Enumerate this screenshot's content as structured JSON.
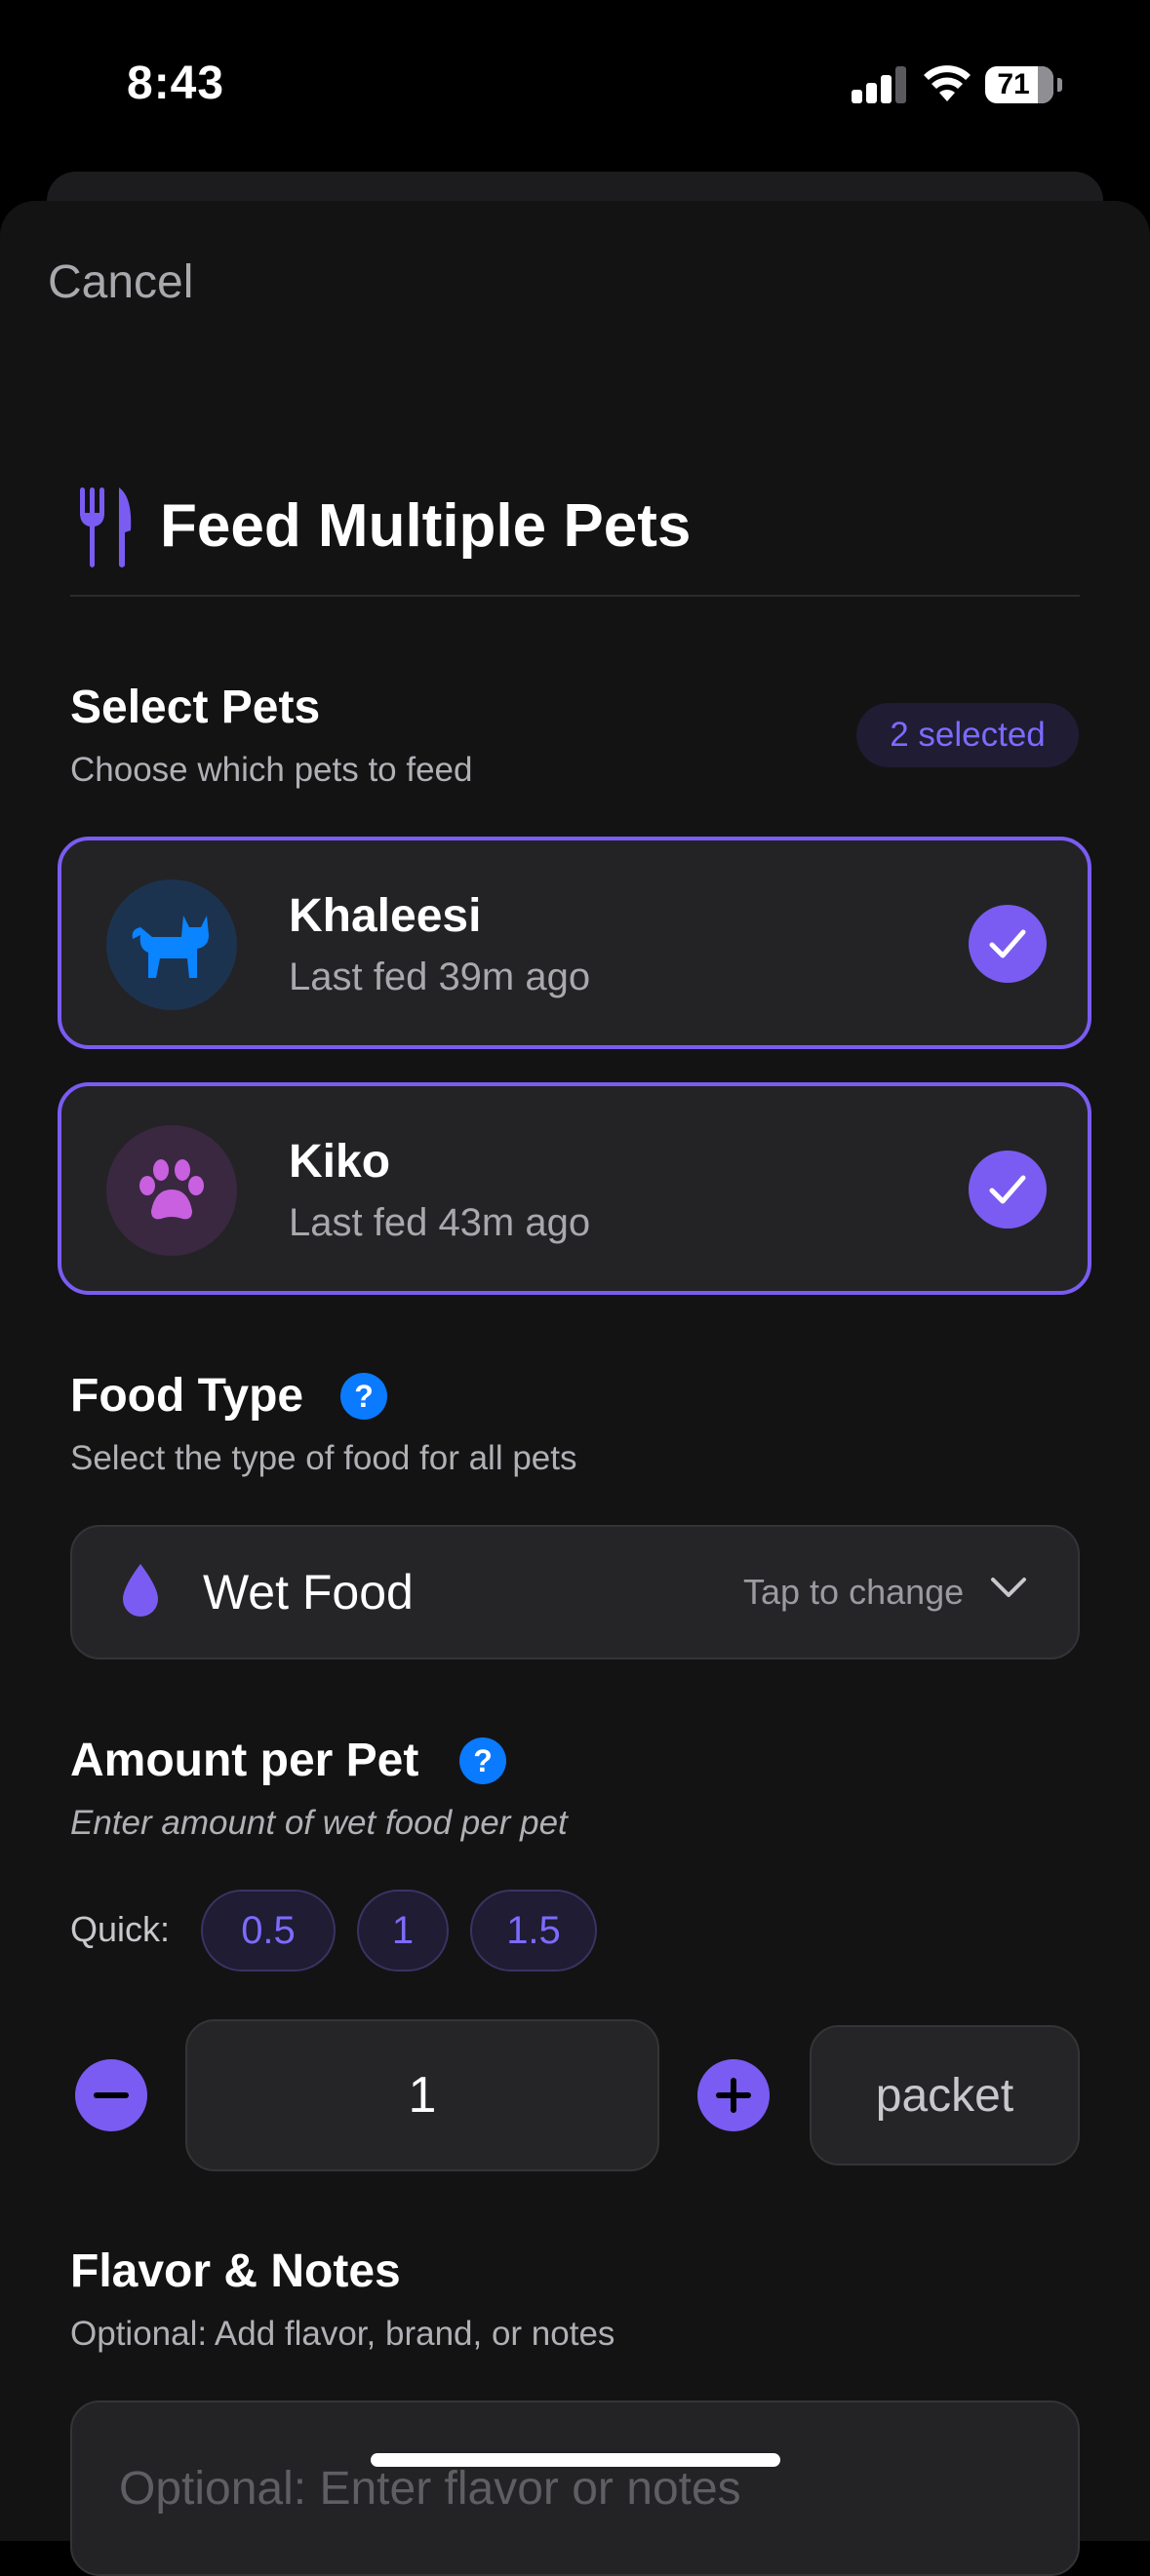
{
  "status_bar": {
    "time": "8:43",
    "battery": "71"
  },
  "header": {
    "cancel_label": "Cancel",
    "title": "Feed Multiple Pets"
  },
  "select_pets": {
    "title": "Select Pets",
    "subtitle": "Choose which pets to feed",
    "badge": "2 selected",
    "pets": [
      {
        "name": "Khaleesi",
        "last_fed": "Last fed 39m ago",
        "icon": "cat-icon",
        "selected": true
      },
      {
        "name": "Kiko",
        "last_fed": "Last fed 43m ago",
        "icon": "paw-icon",
        "selected": true
      }
    ]
  },
  "food_type": {
    "title": "Food Type",
    "subtitle": "Select the type of food for all pets",
    "selected": "Wet Food",
    "hint": "Tap to change"
  },
  "amount": {
    "title": "Amount per Pet",
    "subtitle": "Enter amount of wet food per pet",
    "quick_label": "Quick:",
    "quick_options": [
      "0.5",
      "1",
      "1.5"
    ],
    "value": "1",
    "unit": "packet"
  },
  "notes": {
    "title": "Flavor & Notes",
    "subtitle": "Optional: Add flavor, brand, or notes",
    "placeholder": "Optional: Enter flavor or notes"
  },
  "colors": {
    "accent": "#7a5cf2",
    "help": "#0a7aff",
    "background": "#131314"
  }
}
